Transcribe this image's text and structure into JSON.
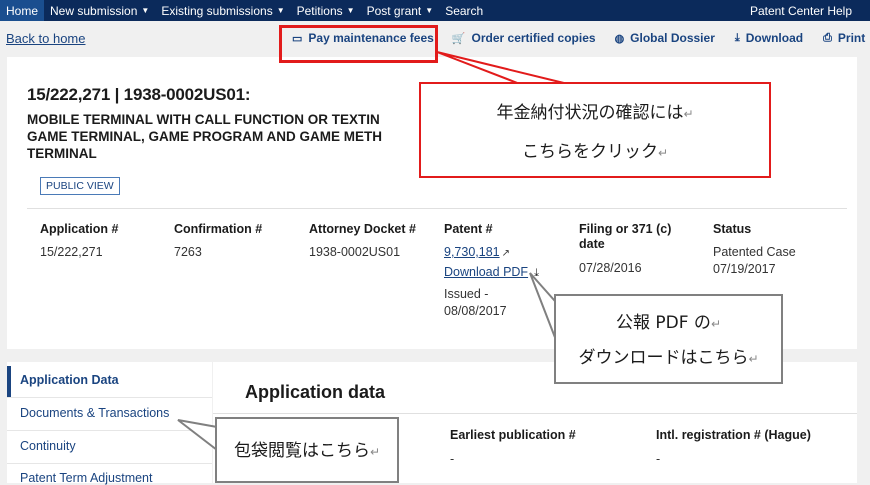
{
  "nav": {
    "items": [
      {
        "label": "Home"
      },
      {
        "label": "New submission"
      },
      {
        "label": "Existing submissions"
      },
      {
        "label": "Petitions"
      },
      {
        "label": "Post grant"
      },
      {
        "label": "Search"
      }
    ],
    "help": "Patent Center Help"
  },
  "back_link": "Back to home",
  "toolbar": {
    "pay": "Pay maintenance fees",
    "order": "Order certified copies",
    "dossier": "Global Dossier",
    "download": "Download",
    "print": "Print"
  },
  "application": {
    "title": "15/222,271 | 1938-0002US01:",
    "description_lines": [
      "MOBILE TERMINAL WITH CALL FUNCTION OR TEXTIN",
      "GAME TERMINAL, GAME PROGRAM AND GAME METH",
      "TERMINAL"
    ],
    "badge": "PUBLIC VIEW"
  },
  "fields": {
    "application": {
      "label": "Application #",
      "value": "15/222,271"
    },
    "confirmation": {
      "label": "Confirmation #",
      "value": "7263"
    },
    "docket": {
      "label": "Attorney Docket #",
      "value": "1938-0002US01"
    },
    "patent": {
      "label": "Patent #",
      "value": "9,730,181",
      "download": "Download PDF",
      "issued_label": "Issued -",
      "issued_date": "08/08/2017"
    },
    "filing": {
      "label": "Filing or 371 (c) date",
      "value": "07/28/2016"
    },
    "status": {
      "label": "Status",
      "value": "Patented Case",
      "date": "07/19/2017"
    }
  },
  "sidebar": {
    "items": [
      {
        "label": "Application Data"
      },
      {
        "label": "Documents & Transactions"
      },
      {
        "label": "Continuity"
      },
      {
        "label": "Patent Term Adjustment"
      }
    ]
  },
  "main": {
    "heading": "Application data",
    "earliest_pub_label": "Earliest publication #",
    "earliest_pub_value": "-",
    "intl_reg_label": "Intl. registration # (Hague)",
    "intl_reg_value": "-"
  },
  "callouts": {
    "c1_line1": "年金納付状況の確認には",
    "c1_line2": "こちらをクリック",
    "c2_line1": "公報 PDF の",
    "c2_line2": "ダウンロードはこちら",
    "c3": "包袋閲覧はこちら",
    "return_mark": "↵"
  },
  "colors": {
    "nav_bg": "#0b2a5b",
    "link": "#1a4480",
    "highlight_red": "#e21b1b",
    "callout_gray": "#808080"
  }
}
